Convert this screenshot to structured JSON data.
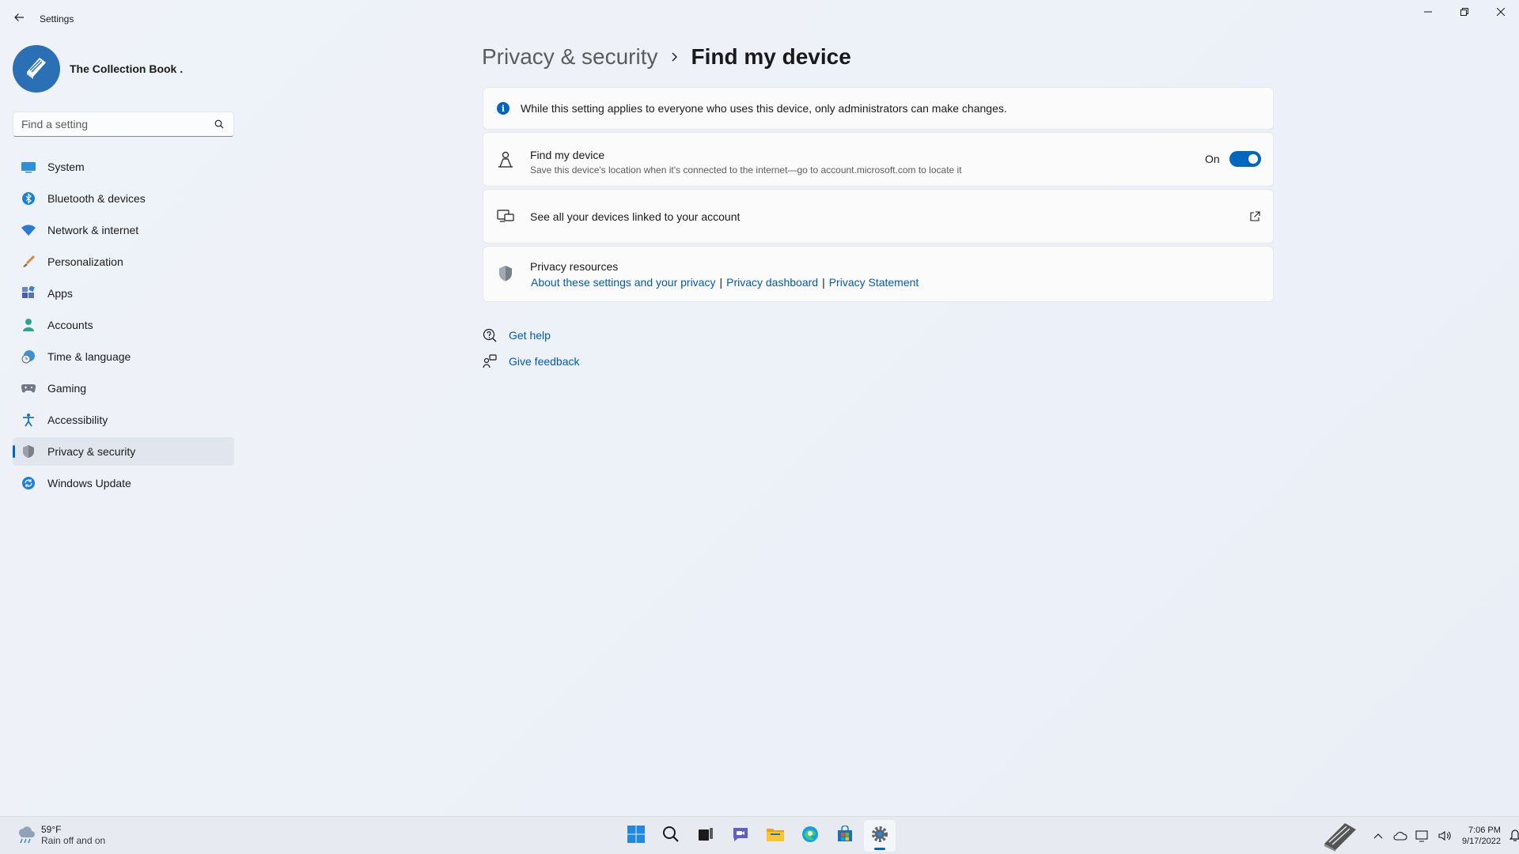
{
  "window": {
    "app_title": "Settings"
  },
  "profile": {
    "name": "The Collection Book ."
  },
  "search": {
    "placeholder": "Find a setting"
  },
  "sidebar": {
    "items": [
      {
        "label": "System",
        "icon": "monitor-icon"
      },
      {
        "label": "Bluetooth & devices",
        "icon": "bluetooth-icon"
      },
      {
        "label": "Network & internet",
        "icon": "wifi-icon"
      },
      {
        "label": "Personalization",
        "icon": "brush-icon"
      },
      {
        "label": "Apps",
        "icon": "apps-icon"
      },
      {
        "label": "Accounts",
        "icon": "person-icon"
      },
      {
        "label": "Time & language",
        "icon": "globe-clock-icon"
      },
      {
        "label": "Gaming",
        "icon": "gamepad-icon"
      },
      {
        "label": "Accessibility",
        "icon": "accessibility-icon"
      },
      {
        "label": "Privacy & security",
        "icon": "shield-icon",
        "active": true
      },
      {
        "label": "Windows Update",
        "icon": "update-icon"
      }
    ]
  },
  "breadcrumb": {
    "parent": "Privacy & security",
    "current": "Find my device"
  },
  "info_banner": {
    "text": "While this setting applies to everyone who uses this device, only administrators can make changes."
  },
  "find_my_device": {
    "title": "Find my device",
    "description": "Save this device's location when it's connected to the internet—go to account.microsoft.com to locate it",
    "toggle_state": "On",
    "enabled": true
  },
  "linked_devices": {
    "title": "See all your devices linked to your account"
  },
  "privacy_resources": {
    "title": "Privacy resources",
    "links": [
      "About these settings and your privacy",
      "Privacy dashboard",
      "Privacy Statement"
    ],
    "separator": "|"
  },
  "help": {
    "get_help": "Get help",
    "give_feedback": "Give feedback"
  },
  "taskbar": {
    "weather_temp": "59°F",
    "weather_condition": "Rain off and on",
    "time": "7:06 PM",
    "date": "9/17/2022",
    "apps": [
      "start-icon",
      "search-icon",
      "task-view-icon",
      "chat-icon",
      "file-explorer-icon",
      "edge-icon",
      "store-icon",
      "settings-icon"
    ]
  },
  "colors": {
    "accent": "#0067c0",
    "link": "#0059b3"
  }
}
